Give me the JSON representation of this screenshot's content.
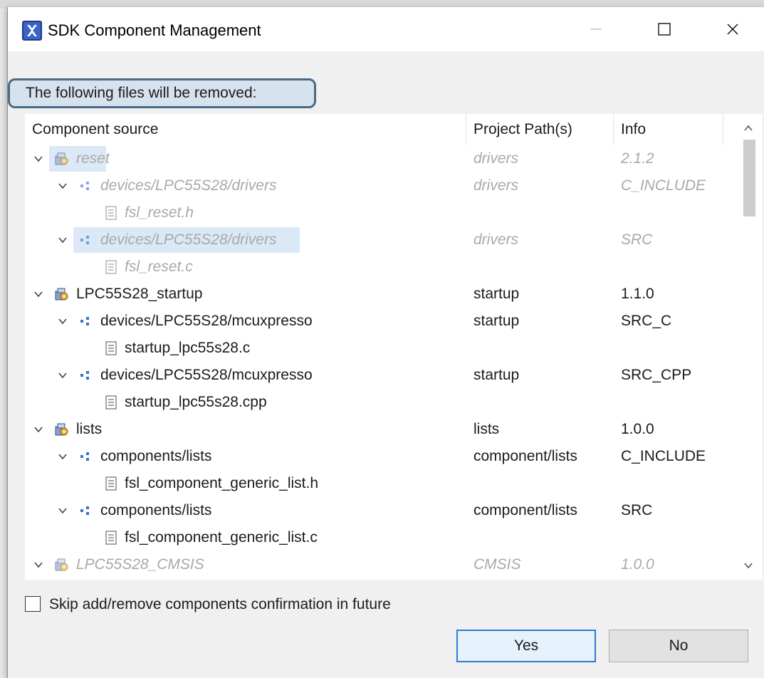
{
  "window": {
    "title": "SDK Component Management",
    "minimize_glyph": "—",
    "maximize_glyph": "☐",
    "close_glyph": "✕"
  },
  "message": "The following files will be removed:",
  "table": {
    "headers": [
      "Component source",
      "Project Path(s)",
      "Info"
    ],
    "rows": [
      {
        "level": 0,
        "type": "component",
        "source": "reset",
        "path": "drivers",
        "info": "2.1.2",
        "muted": true,
        "selected": true
      },
      {
        "level": 1,
        "type": "folder",
        "source": "devices/LPC55S28/drivers",
        "path": "drivers",
        "info": "C_INCLUDE",
        "muted": true,
        "selected": false
      },
      {
        "level": 2,
        "type": "file",
        "source": "fsl_reset.h",
        "path": "",
        "info": "",
        "muted": true,
        "selected": false
      },
      {
        "level": 1,
        "type": "folder",
        "source": "devices/LPC55S28/drivers",
        "path": "drivers",
        "info": "SRC",
        "muted": true,
        "selected": true
      },
      {
        "level": 2,
        "type": "file",
        "source": "fsl_reset.c",
        "path": "",
        "info": "",
        "muted": true,
        "selected": false
      },
      {
        "level": 0,
        "type": "component",
        "source": "LPC55S28_startup",
        "path": "startup",
        "info": "1.1.0",
        "muted": false,
        "selected": false
      },
      {
        "level": 1,
        "type": "folder",
        "source": "devices/LPC55S28/mcuxpresso",
        "path": "startup",
        "info": "SRC_C",
        "muted": false,
        "selected": false
      },
      {
        "level": 2,
        "type": "file",
        "source": "startup_lpc55s28.c",
        "path": "",
        "info": "",
        "muted": false,
        "selected": false
      },
      {
        "level": 1,
        "type": "folder",
        "source": "devices/LPC55S28/mcuxpresso",
        "path": "startup",
        "info": "SRC_CPP",
        "muted": false,
        "selected": false
      },
      {
        "level": 2,
        "type": "file",
        "source": "startup_lpc55s28.cpp",
        "path": "",
        "info": "",
        "muted": false,
        "selected": false
      },
      {
        "level": 0,
        "type": "component",
        "source": "lists",
        "path": "lists",
        "info": "1.0.0",
        "muted": false,
        "selected": false
      },
      {
        "level": 1,
        "type": "folder",
        "source": "components/lists",
        "path": "component/lists",
        "info": "C_INCLUDE",
        "muted": false,
        "selected": false
      },
      {
        "level": 2,
        "type": "file",
        "source": "fsl_component_generic_list.h",
        "path": "",
        "info": "",
        "muted": false,
        "selected": false
      },
      {
        "level": 1,
        "type": "folder",
        "source": "components/lists",
        "path": "component/lists",
        "info": "SRC",
        "muted": false,
        "selected": false
      },
      {
        "level": 2,
        "type": "file",
        "source": "fsl_component_generic_list.c",
        "path": "",
        "info": "",
        "muted": false,
        "selected": false
      },
      {
        "level": 0,
        "type": "component",
        "source": "LPC55S28_CMSIS",
        "path": "CMSIS",
        "info": "1.0.0",
        "muted": true,
        "selected": false
      }
    ]
  },
  "checkbox": {
    "label": "Skip add/remove components confirmation in future",
    "checked": false
  },
  "buttons": {
    "yes": "Yes",
    "no": "No"
  },
  "colors": {
    "accent": "#2b7bd1",
    "muted_text": "#a9a9a9",
    "selection": "#dbe8f5",
    "message_border": "#4a6a85"
  },
  "icons": {
    "component": "component-package-icon",
    "folder": "folder-dots-icon",
    "file": "file-document-icon",
    "expander": "chevron-down-icon"
  }
}
